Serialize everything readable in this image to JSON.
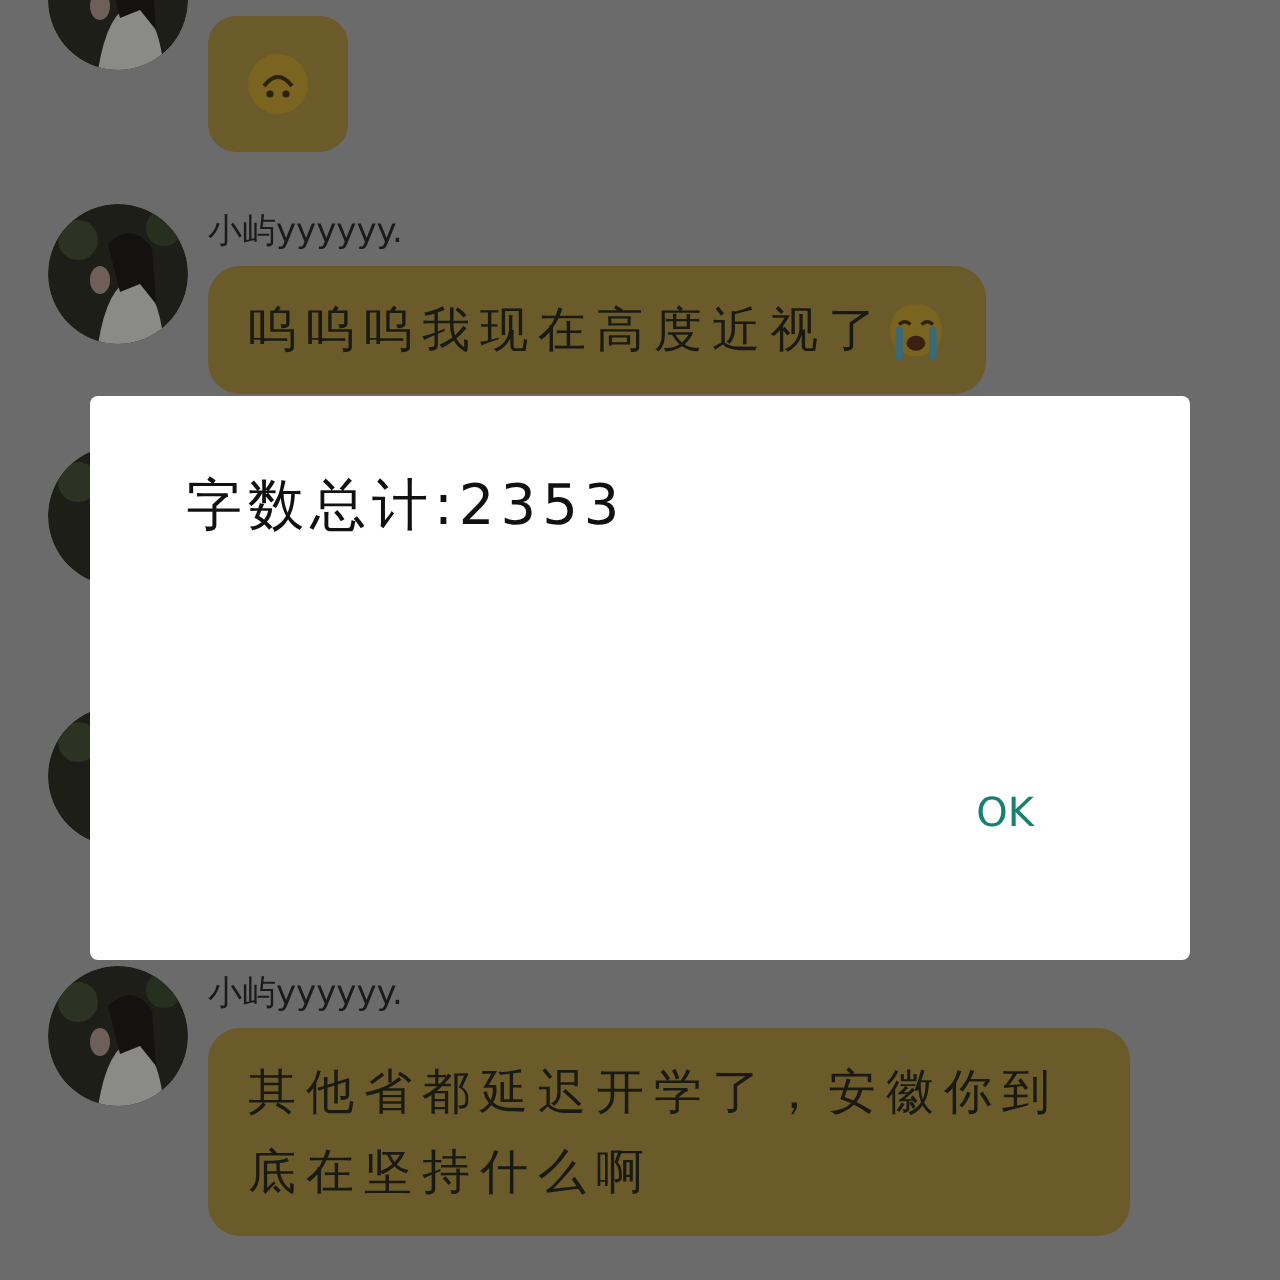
{
  "messages": [
    {
      "kind": "sticker"
    },
    {
      "kind": "text_emoji",
      "name": "小屿yyyyyy.",
      "text": "呜呜呜我现在高度近视了"
    },
    {
      "kind": "hidden"
    },
    {
      "kind": "hidden"
    },
    {
      "kind": "text",
      "name": "小屿yyyyyy.",
      "text": "其他省都延迟开学了，安徽你到底在坚持什么啊"
    }
  ],
  "dialog": {
    "message": "字数总计:2353",
    "button": "OK"
  }
}
